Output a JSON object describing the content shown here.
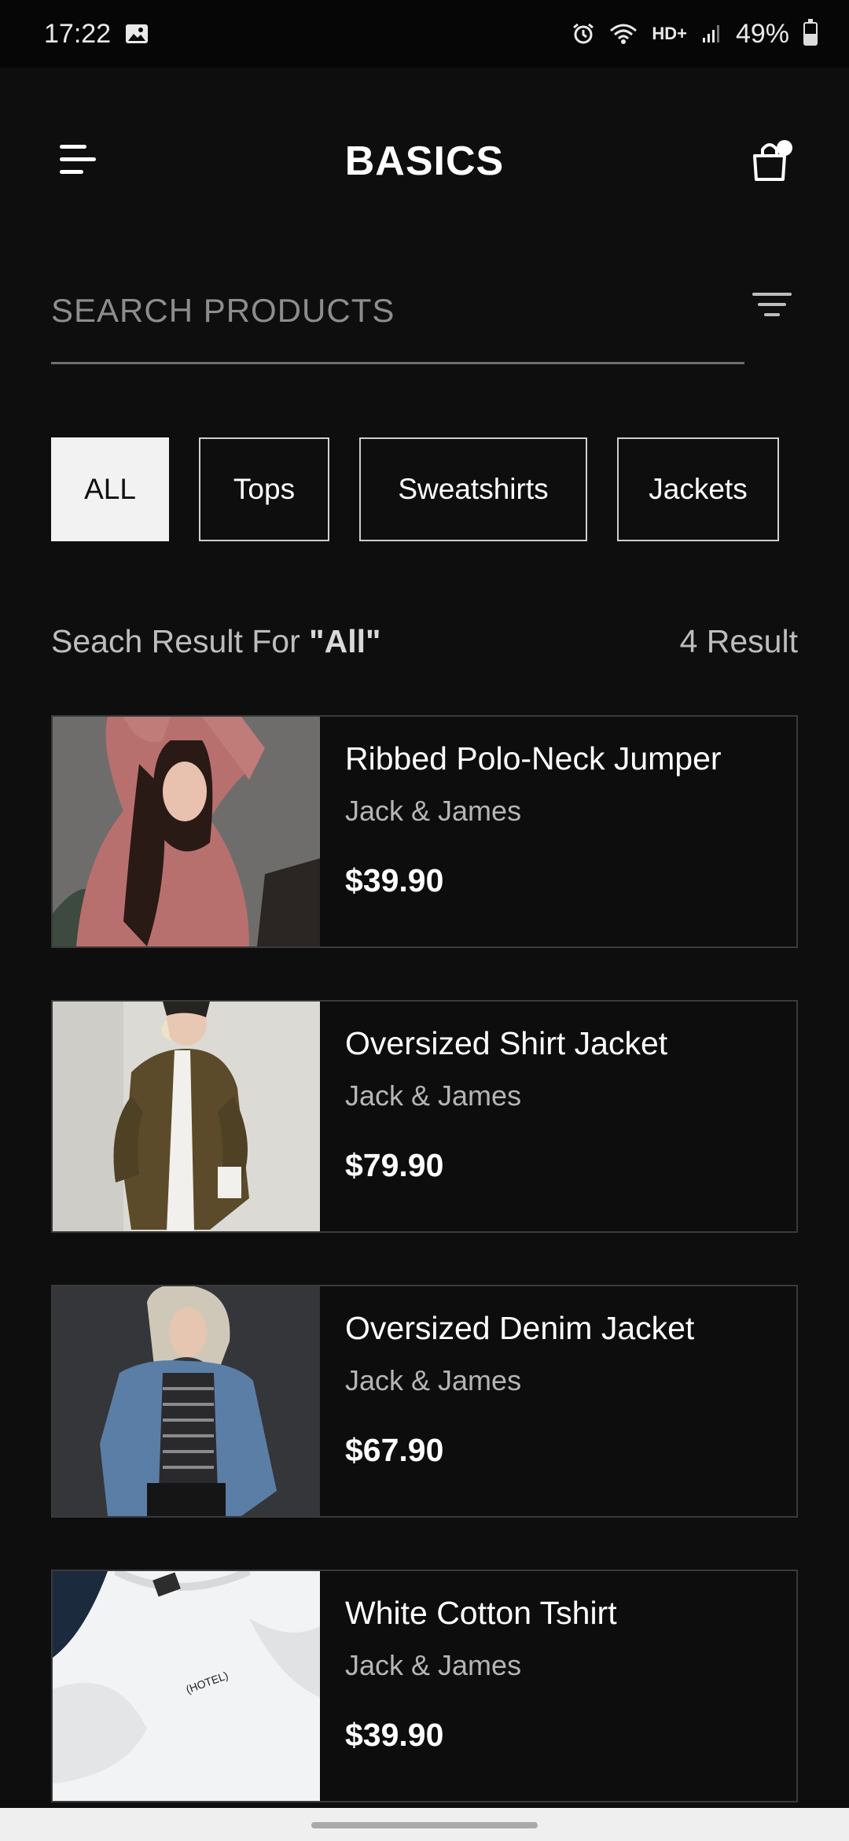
{
  "status_bar": {
    "time": "17:22",
    "network": "HD+",
    "battery": "49%",
    "icons": [
      "image-icon",
      "alarm-icon",
      "wifi-icon",
      "signal-icon",
      "battery-icon"
    ]
  },
  "header": {
    "title": "BASICS",
    "menu_icon": "hamburger-menu-icon",
    "cart_icon": "shopping-bag-icon"
  },
  "search": {
    "placeholder": "SEARCH PRODUCTS",
    "filter_icon": "filter-icon"
  },
  "categories": [
    {
      "label": "ALL",
      "active": true
    },
    {
      "label": "Tops",
      "active": false
    },
    {
      "label": "Sweatshirts",
      "active": false
    },
    {
      "label": "Jackets",
      "active": false
    }
  ],
  "results": {
    "prefix": "Seach Result For ",
    "query": "\"All\"",
    "count": "4 Result"
  },
  "products": [
    {
      "name": "Ribbed Polo-Neck Jumper",
      "brand": "Jack & James",
      "price": "$39.90"
    },
    {
      "name": "Oversized Shirt Jacket",
      "brand": "Jack & James",
      "price": "$79.90"
    },
    {
      "name": "Oversized Denim Jacket",
      "brand": "Jack & James",
      "price": "$67.90"
    },
    {
      "name": "White Cotton Tshirt",
      "brand": "Jack & James",
      "price": "$39.90",
      "print": "(HOTEL)"
    }
  ],
  "colors": {
    "background": "#0e0e0f",
    "active_chip": "#f2f2f2",
    "card_border": "#3a3a3a"
  }
}
